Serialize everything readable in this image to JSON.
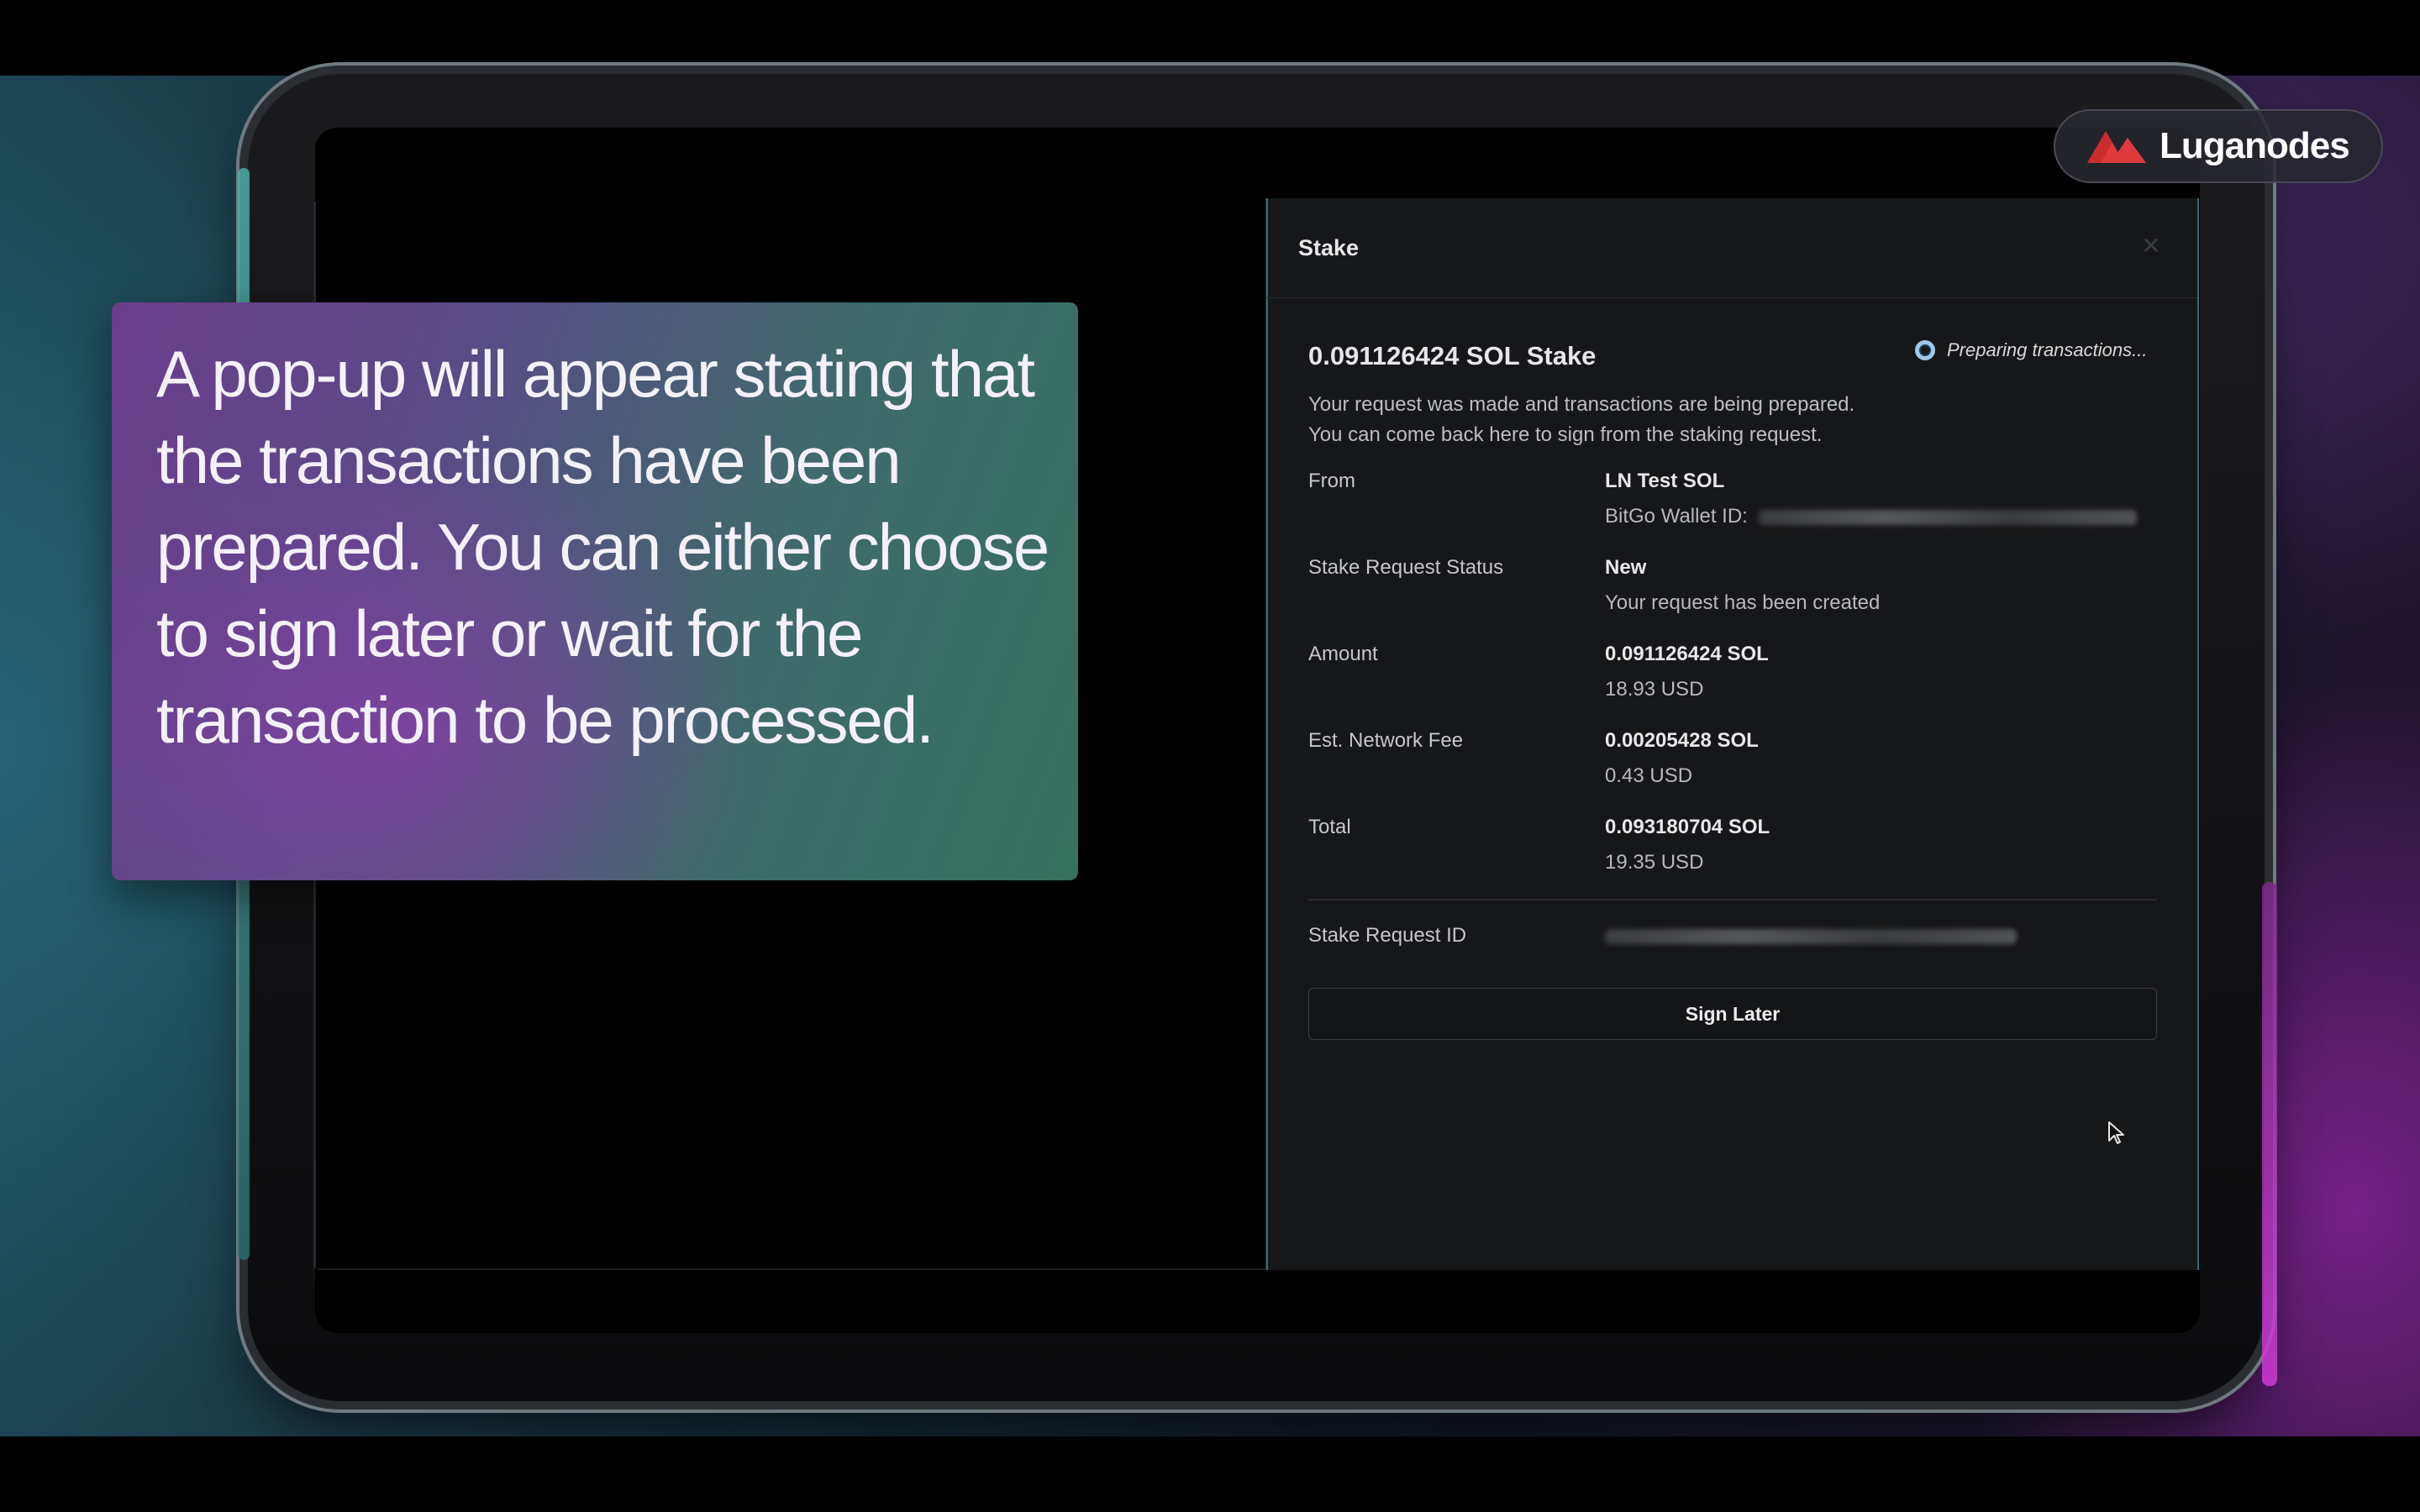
{
  "brand": {
    "name": "Luganodes",
    "accent": "#e03a3e"
  },
  "caption": {
    "text": "A pop-up will appear stating that the transactions have been prepared. You can either choose to sign later or wait for the transaction to be processed."
  },
  "modal": {
    "title": "Stake",
    "close_icon": "close-icon",
    "stake_amount": "0.091126424 SOL Stake",
    "status": "Preparing transactions...",
    "description": [
      "Your request was made and transactions are being prepared.",
      "You can come back here to sign from the staking request."
    ],
    "rows": {
      "from": {
        "label": "From",
        "value": "LN Test SOL",
        "sub_prefix": "BitGo Wallet ID:"
      },
      "status": {
        "label": "Stake Request Status",
        "value": "New",
        "sub": "Your request has been created"
      },
      "amount": {
        "label": "Amount",
        "value": "0.091126424 SOL",
        "sub": "18.93 USD"
      },
      "fee": {
        "label": "Est. Network Fee",
        "value": "0.00205428 SOL",
        "sub": "0.43 USD"
      },
      "total": {
        "label": "Total",
        "value": "0.093180704 SOL",
        "sub": "19.35 USD"
      },
      "request_id": {
        "label": "Stake Request ID"
      }
    },
    "sign_later_label": "Sign Later"
  }
}
